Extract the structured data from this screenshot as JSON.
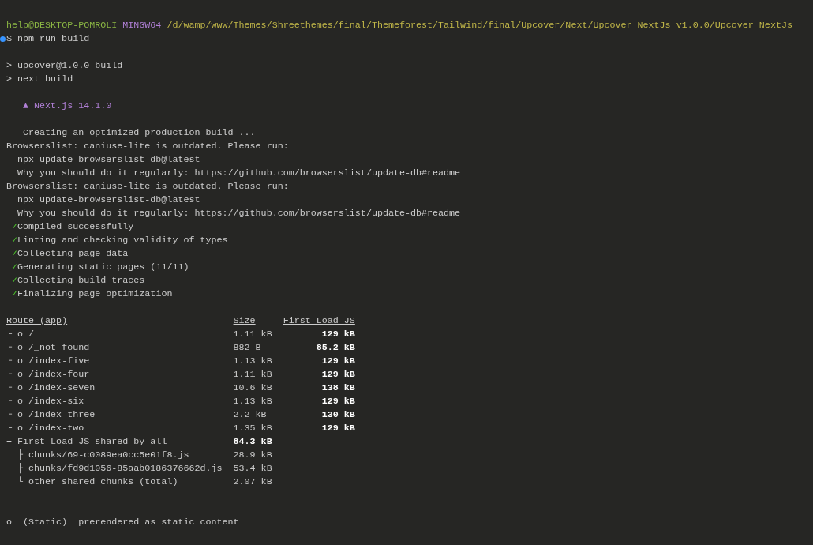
{
  "prompt": {
    "user": "help@DESKTOP-POMROLI",
    "shell": "MINGW64",
    "path": "/d/wamp/www/Themes/Shreethemes/final/Themeforest/Tailwind/final/Upcover/Next/Upcover_NextJs_v1.0.0/Upcover_NextJs"
  },
  "command": {
    "symbol": "$",
    "text": "npm run build",
    "success": true
  },
  "script_lines": [
    "> upcover@1.0.0 build",
    "> next build"
  ],
  "banner": {
    "symbol": "▲",
    "text": "Next.js 14.1.0"
  },
  "output": [
    {
      "kind": "info",
      "text": "Creating an optimized production build ..."
    },
    {
      "kind": "warn",
      "text": "Browserslist: caniuse-lite is outdated. Please run:"
    },
    {
      "kind": "hint",
      "text": "npx update-browserslist-db@latest"
    },
    {
      "kind": "hint",
      "text": "Why you should do it regularly: https://github.com/browserslist/update-db#readme"
    },
    {
      "kind": "warn",
      "text": "Browserslist: caniuse-lite is outdated. Please run:"
    },
    {
      "kind": "hint",
      "text": "npx update-browserslist-db@latest"
    },
    {
      "kind": "hint",
      "text": "Why you should do it regularly: https://github.com/browserslist/update-db#readme"
    },
    {
      "kind": "check",
      "mark": "✓",
      "text": "Compiled successfully"
    },
    {
      "kind": "check",
      "mark": "✓",
      "text": "Linting and checking validity of types"
    },
    {
      "kind": "check",
      "mark": "✓",
      "text": "Collecting page data"
    },
    {
      "kind": "check",
      "mark": "✓",
      "text": "Generating static pages (11/11)"
    },
    {
      "kind": "check",
      "mark": "✓",
      "text": "Collecting build traces"
    },
    {
      "kind": "check",
      "mark": "✓",
      "text": "Finalizing page optimization"
    }
  ],
  "table": {
    "columns": [
      "Route (app)",
      "Size",
      "First Load JS"
    ],
    "rows": [
      {
        "route": "┌ o /",
        "size": "1.11 kB",
        "first_load": "129 kB"
      },
      {
        "route": "├ o /_not-found",
        "size": "882 B",
        "first_load": "85.2 kB"
      },
      {
        "route": "├ o /index-five",
        "size": "1.13 kB",
        "first_load": "129 kB"
      },
      {
        "route": "├ o /index-four",
        "size": "1.11 kB",
        "first_load": "129 kB"
      },
      {
        "route": "├ o /index-seven",
        "size": "10.6 kB",
        "first_load": "138 kB"
      },
      {
        "route": "├ o /index-six",
        "size": "1.13 kB",
        "first_load": "129 kB"
      },
      {
        "route": "├ o /index-three",
        "size": "2.2 kB",
        "first_load": "130 kB"
      },
      {
        "route": "└ o /index-two",
        "size": "1.35 kB",
        "first_load": "129 kB"
      }
    ],
    "shared": {
      "label": "+ First Load JS shared by all",
      "size": "84.3 kB"
    },
    "chunks": [
      {
        "name": "├ chunks/69-c0089ea0cc5e01f8.js",
        "size": "28.9 kB"
      },
      {
        "name": "├ chunks/fd9d1056-85aab0186376662d.js",
        "size": "53.4 kB"
      },
      {
        "name": "└ other shared chunks (total)",
        "size": "2.07 kB"
      }
    ]
  },
  "legend": {
    "symbol": "o",
    "type": "(Static)",
    "description": "prerendered as static content"
  }
}
